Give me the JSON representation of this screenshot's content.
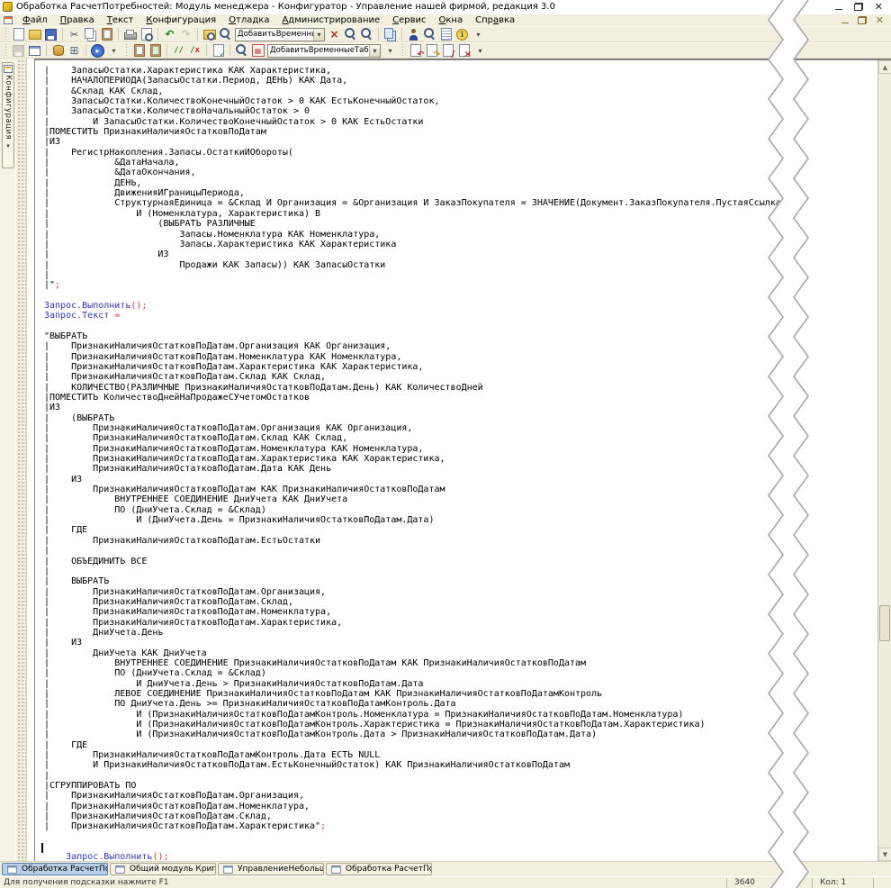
{
  "colors": {
    "code_identifier": "#3333cc",
    "code_punctuation": "#ee3333",
    "taskbar_active": "#b9cfe8",
    "ui_background": "#f2efdf"
  },
  "window": {
    "title": "Обработка РасчетПотребностей: Модуль менеджера - Конфигуратор - Управление нашей фирмой, редакция 3.0"
  },
  "menu": {
    "items": [
      {
        "label": "Файл",
        "u": 0,
        "name": "menu-file"
      },
      {
        "label": "Правка",
        "u": 0,
        "name": "menu-edit"
      },
      {
        "label": "Текст",
        "u": 0,
        "name": "menu-text"
      },
      {
        "label": "Конфигурация",
        "u": 0,
        "name": "menu-configuration"
      },
      {
        "label": "Отладка",
        "u": 0,
        "name": "menu-debug"
      },
      {
        "label": "Администрирование",
        "u": 0,
        "name": "menu-administration"
      },
      {
        "label": "Сервис",
        "u": 0,
        "name": "menu-service"
      },
      {
        "label": "Окна",
        "u": 0,
        "name": "menu-windows"
      },
      {
        "label": "Справка",
        "u": 3,
        "name": "menu-help"
      }
    ]
  },
  "toolbars": {
    "row1": [
      {
        "type": "grip"
      },
      {
        "type": "page",
        "name": "new-document-button"
      },
      {
        "type": "folder",
        "name": "open-button"
      },
      {
        "type": "disk",
        "name": "save-button"
      },
      {
        "type": "sep"
      },
      {
        "type": "cut",
        "name": "cut-button"
      },
      {
        "type": "copy",
        "name": "copy-button"
      },
      {
        "type": "clip",
        "name": "paste-button"
      },
      {
        "type": "sep"
      },
      {
        "type": "print",
        "name": "print-button"
      },
      {
        "type": "preview",
        "name": "print-preview-button"
      },
      {
        "type": "sep"
      },
      {
        "type": "undo",
        "name": "undo-button"
      },
      {
        "type": "redo",
        "name": "redo-button",
        "disabled": true
      },
      {
        "type": "sep"
      },
      {
        "type": "magfolder",
        "name": "global-search-button"
      },
      {
        "type": "mag",
        "name": "find-button"
      },
      {
        "type": "combo",
        "name": "search-text-combobox",
        "value": "ДобавитьВременныеТ",
        "width": 100
      },
      {
        "type": "clearx",
        "name": "clear-search-button"
      },
      {
        "type": "magnext",
        "name": "find-next-button"
      },
      {
        "type": "magprev",
        "name": "find-previous-button"
      },
      {
        "type": "sep"
      },
      {
        "type": "pages",
        "name": "copy-special-button"
      },
      {
        "type": "sep"
      },
      {
        "type": "person",
        "name": "syntax-check-button"
      },
      {
        "type": "maghelp",
        "name": "help-search-button"
      },
      {
        "type": "doc",
        "name": "procedures-functions-button"
      },
      {
        "type": "info",
        "name": "about-button"
      },
      {
        "type": "more",
        "name": "toolbar1-overflow-button"
      }
    ],
    "row2": [
      {
        "type": "grip"
      },
      {
        "type": "diskgray",
        "name": "save-configuration-button",
        "disabled": true
      },
      {
        "type": "form",
        "name": "open-form-button"
      },
      {
        "type": "sep"
      },
      {
        "type": "db",
        "name": "database-update-button"
      },
      {
        "type": "table",
        "name": "table-button"
      },
      {
        "type": "sep"
      },
      {
        "type": "play",
        "name": "start-debugging-button"
      },
      {
        "type": "more",
        "name": "debug-options-button"
      },
      {
        "type": "grip"
      },
      {
        "type": "clip",
        "name": "template-1-button"
      },
      {
        "type": "clip2",
        "name": "template-2-button"
      },
      {
        "type": "sep"
      },
      {
        "type": "comment",
        "name": "add-comment-button"
      },
      {
        "type": "uncomment",
        "name": "remove-comment-button"
      },
      {
        "type": "sep"
      },
      {
        "type": "pagecheck",
        "name": "format-module-button"
      },
      {
        "type": "sep"
      },
      {
        "type": "maggear",
        "name": "find-procedure-button"
      },
      {
        "type": "pq",
        "name": "query-constructor-icon"
      },
      {
        "type": "combo",
        "name": "procedure-combobox",
        "value": "ДобавитьВременныеТаблицыГ",
        "width": 126
      },
      {
        "type": "more",
        "name": "toolbar2-overflow-button"
      },
      {
        "type": "grip"
      },
      {
        "type": "pg1",
        "name": "module-back-button"
      },
      {
        "type": "pg2",
        "name": "module-refresh-button"
      },
      {
        "type": "pg3",
        "name": "module-edit-button"
      },
      {
        "type": "pg4",
        "name": "module-delete-button"
      },
      {
        "type": "more",
        "name": "toolbar3-overflow-button"
      }
    ]
  },
  "sidebar": {
    "tab_label": "Конфигурация"
  },
  "editor": {
    "lines": [
      "|    ЗапасыОстатки.Характеристика КАК Характеристика,",
      "|    НАЧАЛОПЕРИОДА(ЗапасыОстатки.Период, ДЕНЬ) КАК Дата,",
      "|    &Склад КАК Склад,",
      "|    ЗапасыОстатки.КоличествоКонечныйОстаток > 0 КАК ЕстьКонечныйОстаток,",
      "|    ЗапасыОстатки.КоличествоНачальныйОстаток > 0",
      "|        И ЗапасыОстатки.КоличествоКонечныйОстаток > 0 КАК ЕстьОстатки",
      "|ПОМЕСТИТЬ ПризнакиНаличияОстатковПоДатам",
      "|ИЗ",
      "|    РегистрНакопления.Запасы.ОстаткиИОбороты(",
      "|            &ДатаНачала,",
      "|            &ДатаОкончания,",
      "|            ДЕНЬ,",
      "|            ДвиженияИГраницыПериода,",
      "|            СтруктурнаяЕдиница = &Склад И Организация = &Организация И ЗаказПокупателя = ЗНАЧЕНИЕ(Документ.ЗаказПокупателя.ПустаяСсылка)",
      "|                И (Номенклатура, Характеристика) В",
      "|                    (ВЫБРАТЬ РАЗЛИЧНЫЕ",
      "|                        Запасы.Номенклатура КАК Номенклатура,",
      "|                        Запасы.Характеристика КАК Характеристика",
      "|                    ИЗ",
      "|                        Продажи КАК Запасы)) КАК ЗапасыОстатки",
      "|",
      {
        "seg": [
          [
            "|\"",
            "k"
          ],
          [
            ";",
            "r"
          ]
        ]
      },
      "",
      {
        "seg": [
          [
            "Запрос",
            "b"
          ],
          [
            ".",
            "r"
          ],
          [
            "Выполнить",
            "b"
          ],
          [
            "();",
            "r"
          ]
        ]
      },
      {
        "seg": [
          [
            "Запрос",
            "b"
          ],
          [
            ".",
            "r"
          ],
          [
            "Текст",
            "b"
          ],
          [
            " ",
            "k"
          ],
          [
            "=",
            "r"
          ]
        ]
      },
      "",
      "\"ВЫБРАТЬ",
      "|    ПризнакиНаличияОстатковПоДатам.Организация КАК Организация,",
      "|    ПризнакиНаличияОстатковПоДатам.Номенклатура КАК Номенклатура,",
      "|    ПризнакиНаличияОстатковПоДатам.Характеристика КАК Характеристика,",
      "|    ПризнакиНаличияОстатковПоДатам.Склад КАК Склад,",
      "|    КОЛИЧЕСТВО(РАЗЛИЧНЫЕ ПризнакиНаличияОстатковПоДатам.День) КАК КоличествоДней",
      "|ПОМЕСТИТЬ КоличествоДнейНаПродажеСУчетомОстатков",
      "|ИЗ",
      "|    (ВЫБРАТЬ",
      "|        ПризнакиНаличияОстатковПоДатам.Организация КАК Организация,",
      "|        ПризнакиНаличияОстатковПоДатам.Склад КАК Склад,",
      "|        ПризнакиНаличияОстатковПоДатам.Номенклатура КАК Номенклатура,",
      "|        ПризнакиНаличияОстатковПоДатам.Характеристика КАК Характеристика,",
      "|        ПризнакиНаличияОстатковПоДатам.Дата КАК День",
      "|    ИЗ",
      "|        ПризнакиНаличияОстатковПоДатам КАК ПризнакиНаличияОстатковПоДатам",
      "|            ВНУТРЕННЕЕ СОЕДИНЕНИЕ ДниУчета КАК ДниУчета",
      "|            ПО (ДниУчета.Склад = &Склад)",
      "|                И (ДниУчета.День = ПризнакиНаличияОстатковПоДатам.Дата)",
      "|    ГДЕ",
      "|        ПризнакиНаличияОстатковПоДатам.ЕстьОстатки",
      "|",
      "|    ОБЪЕДИНИТЬ ВСЕ",
      "|",
      "|    ВЫБРАТЬ",
      "|        ПризнакиНаличияОстатковПоДатам.Организация,",
      "|        ПризнакиНаличияОстатковПоДатам.Склад,",
      "|        ПризнакиНаличияОстатковПоДатам.Номенклатура,",
      "|        ПризнакиНаличияОстатковПоДатам.Характеристика,",
      "|        ДниУчета.День",
      "|    ИЗ",
      "|        ДниУчета КАК ДниУчета",
      "|            ВНУТРЕННЕЕ СОЕДИНЕНИЕ ПризнакиНаличияОстатковПоДатам КАК ПризнакиНаличияОстатковПоДатам",
      "|            ПО (ДниУчета.Склад = &Склад)",
      "|                И ДниУчета.День > ПризнакиНаличияОстатковПоДатам.Дата",
      "|            ЛЕВОЕ СОЕДИНЕНИЕ ПризнакиНаличияОстатковПоДатам КАК ПризнакиНаличияОстатковПоДатамКонтроль",
      "|            ПО ДниУчета.День >= ПризнакиНаличияОстатковПоДатамКонтроль.Дата",
      "|                И (ПризнакиНаличияОстатковПоДатамКонтроль.Номенклатура = ПризнакиНаличияОстатковПоДатам.Номенклатура)",
      "|                И (ПризнакиНаличияОстатковПоДатамКонтроль.Характеристика = ПризнакиНаличияОстатковПоДатам.Характеристика)",
      "|                И (ПризнакиНаличияОстатковПоДатамКонтроль.Дата > ПризнакиНаличияОстатковПоДатам.Дата)",
      "|    ГДЕ",
      "|        ПризнакиНаличияОстатковПоДатамКонтроль.Дата ЕСТЬ NULL",
      "|        И ПризнакиНаличияОстатковПоДатам.ЕстьКонечныйОстаток) КАК ПризнакиНаличияОстатковПоДатам",
      "|",
      "|СГРУППИРОВАТЬ ПО",
      "|    ПризнакиНаличияОстатковПоДатам.Организация,",
      "|    ПризнакиНаличияОстатковПоДатам.Номенклатура,",
      "|    ПризнакиНаличияОстатковПоДатам.Склад,",
      {
        "seg": [
          [
            "|    ПризнакиНаличияОстатковПоДатам.Характеристика\"",
            "k"
          ],
          [
            ";",
            "r"
          ]
        ]
      },
      "",
      "",
      {
        "seg": [
          [
            "    ",
            "k"
          ],
          [
            "Запрос",
            "b"
          ],
          [
            ".",
            "r"
          ],
          [
            "Выполнить",
            "b"
          ],
          [
            "();",
            "r"
          ]
        ]
      }
    ]
  },
  "taskbar": {
    "buttons": [
      {
        "label": "Обработка РасчетПотребно...",
        "active": true
      },
      {
        "label": "Общий модуль Криптограф...",
        "active": false
      },
      {
        "label": "УправлениеНебольшойФир...",
        "active": false
      },
      {
        "label": "Обработка РасчетПотребно...",
        "active": false
      }
    ]
  },
  "statusbar": {
    "hint": "Для получения подсказки нажмите F1",
    "line_indicator": "3640",
    "column_indicator": "Кол: 1"
  }
}
